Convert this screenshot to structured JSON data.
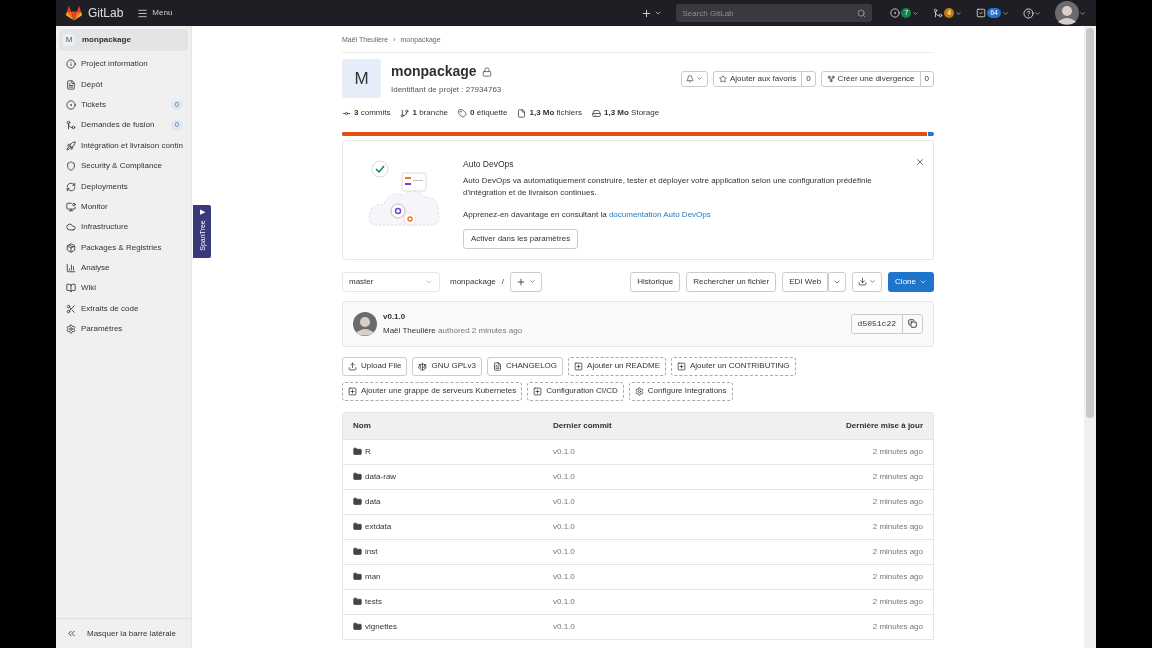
{
  "navbar": {
    "brand": "GitLab",
    "menu": "Menu",
    "search": {
      "placeholder": "Search GitLab"
    },
    "counters": [
      {
        "kind": "issues",
        "count": "7",
        "color": "#108548"
      },
      {
        "kind": "merge",
        "count": "4",
        "color": "#c17d10"
      },
      {
        "kind": "todo",
        "count": "64",
        "color": "#1f75cb"
      }
    ]
  },
  "sidebar": {
    "project_initial": "M",
    "project_name": "monpackage",
    "items": [
      {
        "label": "Project information"
      },
      {
        "label": "Dépôt"
      },
      {
        "label": "Tickets",
        "count": "0"
      },
      {
        "label": "Demandes de fusion",
        "count": "0"
      },
      {
        "label": "Intégration et livraison contin"
      },
      {
        "label": "Security & Compliance"
      },
      {
        "label": "Deployments"
      },
      {
        "label": "Monitor"
      },
      {
        "label": "Infrastructure"
      },
      {
        "label": "Packages & Registries"
      },
      {
        "label": "Analyse"
      },
      {
        "label": "Wiki"
      },
      {
        "label": "Extraits de code"
      },
      {
        "label": "Paramètres"
      }
    ],
    "collapse": "Masquer la barre latérale"
  },
  "spantree": {
    "arrow": "▶",
    "label": "SpanTree"
  },
  "breadcrumb": {
    "items": [
      "Maël Theulière",
      "monpackage"
    ],
    "separator": "›"
  },
  "project": {
    "avatar": "M",
    "name": "monpackage",
    "id": "Identifiant de projet : 27934763",
    "actions": [
      {
        "kind": "star",
        "label": "Ajouter aux favoris",
        "count": "0"
      },
      {
        "kind": "fork",
        "label": "Créer une divergence",
        "count": "0"
      }
    ],
    "stats": [
      {
        "kind": "commit",
        "value": "3",
        "label": "commits"
      },
      {
        "kind": "branch",
        "value": "1",
        "label": "branche"
      },
      {
        "kind": "tag",
        "value": "0",
        "label": "étiquette"
      },
      {
        "kind": "file",
        "value": "1,3 Mo",
        "label": "fichiers"
      },
      {
        "kind": "storage",
        "value": "1,3 Mo",
        "label": "Storage"
      }
    ],
    "language_bar": {
      "level": 0.99
    }
  },
  "autodevops": {
    "title": "Auto DevOps",
    "text": "Auto DevOps va automatiquement construire, tester et déployer votre application selon une configuration prédéfinie d'intégration et de livraison continues.",
    "learn": "Apprenez-en davantage en consultant la",
    "link": "documentation Auto DevOps",
    "button": "Activer dans les paramètres"
  },
  "repo_bar": {
    "branch": "master",
    "path": "monpackage",
    "separator": "/",
    "buttons": [
      "Historique",
      "Rechercher un fichier",
      "EDI Web"
    ],
    "clone": "Clone"
  },
  "last_commit": {
    "title": "v0.1.0",
    "author": "Maël Theulière",
    "meta": "authored 2 minutes ago",
    "sha": "d5051c22"
  },
  "shortcuts": [
    {
      "kind": "upload",
      "label": "Upload File",
      "dashed": false
    },
    {
      "kind": "license",
      "label": "GNU GPLv3",
      "dashed": false
    },
    {
      "kind": "file",
      "label": "CHANGELOG",
      "dashed": false
    },
    {
      "kind": "add",
      "label": "Ajouter un README",
      "dashed": true
    },
    {
      "kind": "add",
      "label": "Ajouter un CONTRIBUTING",
      "dashed": true
    },
    {
      "kind": "add",
      "label": "Ajouter une grappe de serveurs Kubernetes",
      "dashed": true
    },
    {
      "kind": "add",
      "label": "Configuration CI/CD",
      "dashed": true
    },
    {
      "kind": "gear",
      "label": "Configure Integrations",
      "dashed": true
    }
  ],
  "table": {
    "columns": [
      "Nom",
      "Dernier commit",
      "Dernière mise à jour"
    ],
    "rows": [
      {
        "name": "R",
        "commit": "v0.1.0",
        "updated": "2 minutes ago"
      },
      {
        "name": "data-raw",
        "commit": "v0.1.0",
        "updated": "2 minutes ago"
      },
      {
        "name": "data",
        "commit": "v0.1.0",
        "updated": "2 minutes ago"
      },
      {
        "name": "extdata",
        "commit": "v0.1.0",
        "updated": "2 minutes ago"
      },
      {
        "name": "inst",
        "commit": "v0.1.0",
        "updated": "2 minutes ago"
      },
      {
        "name": "man",
        "commit": "v0.1.0",
        "updated": "2 minutes ago"
      },
      {
        "name": "tests",
        "commit": "v0.1.0",
        "updated": "2 minutes ago"
      },
      {
        "name": "vignettes",
        "commit": "v0.1.0",
        "updated": "2 minutes ago"
      }
    ]
  }
}
